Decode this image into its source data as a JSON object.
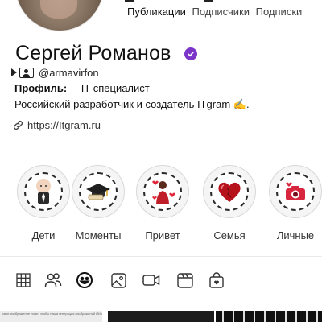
{
  "profile": {
    "name": "Сергей Романов",
    "handle": "@armavirfon",
    "profile_label": "Профиль:",
    "profile_value": "IT специалист",
    "bio": "Российский разработчик и создатель ITgram ✍️.",
    "link": "https://Itgram.ru",
    "verified_color": "#7b36c9"
  },
  "stats": {
    "posts_label": "Публикации",
    "followers_label": "Подписчики",
    "following_label": "Подписки"
  },
  "highlights": [
    {
      "label": "Дети",
      "icon": "baby-icon"
    },
    {
      "label": "Моменты",
      "icon": "graduation-cap-icon"
    },
    {
      "label": "Привет",
      "icon": "girl-with-hearts-icon"
    },
    {
      "label": "Семья",
      "icon": "heart-icon"
    },
    {
      "label": "Личные",
      "icon": "camera-icon"
    }
  ],
  "tabs": [
    "grid-icon",
    "people-icon",
    "emoji-icon",
    "image-icon",
    "video-icon",
    "clapper-icon",
    "bag-icon"
  ],
  "thumb_text": "свое изображение ниже, чтобы наша генерация изображений ИИ сгенерировала для вас 4"
}
